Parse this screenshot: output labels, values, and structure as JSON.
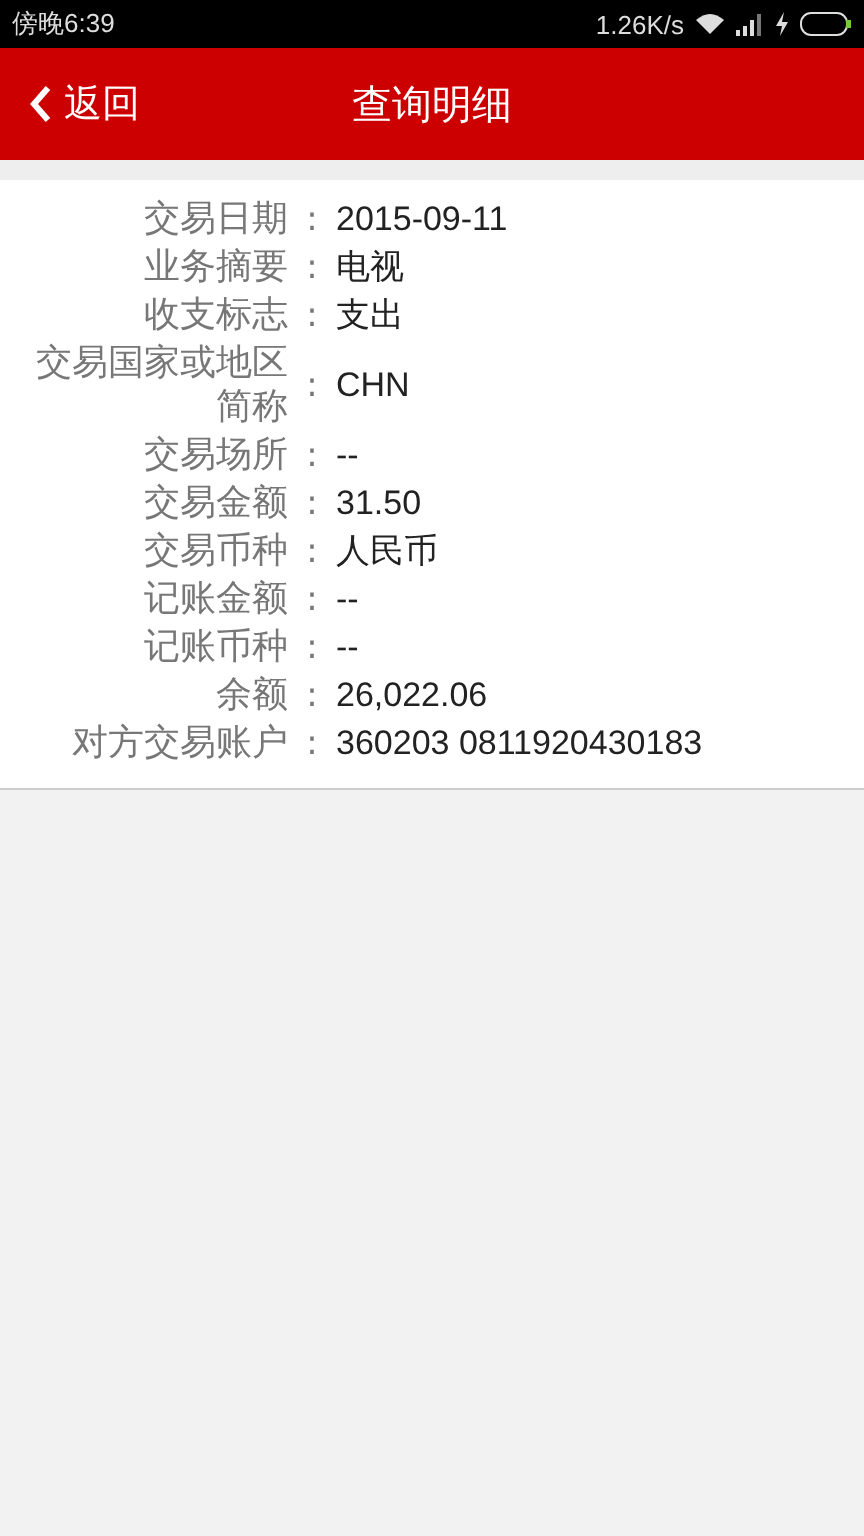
{
  "status_bar": {
    "time": "傍晚6:39",
    "speed": "1.26K/s"
  },
  "header": {
    "back": "返回",
    "title": "查询明细"
  },
  "rows": [
    {
      "label": "交易日期",
      "separator": ":",
      "value": "2015-09-11"
    },
    {
      "label": "业务摘要",
      "separator": ":",
      "value": "电视"
    },
    {
      "label": "收支标志",
      "separator": ":",
      "value": "支出"
    },
    {
      "label": "交易国家或地区简称",
      "separator": ":",
      "value": "CHN"
    },
    {
      "label": "交易场所",
      "separator": ":",
      "value": "--"
    },
    {
      "label": "交易金额",
      "separator": ":",
      "value": "31.50"
    },
    {
      "label": "交易币种",
      "separator": ":",
      "value": "人民币"
    },
    {
      "label": "记账金额",
      "separator": ":",
      "value": "--"
    },
    {
      "label": "记账币种",
      "separator": ":",
      "value": "--"
    },
    {
      "label": "余额",
      "separator": ":",
      "value": "26,022.06"
    },
    {
      "label": "对方交易账户",
      "separator": ":",
      "value": "360203 0811920430183"
    }
  ]
}
